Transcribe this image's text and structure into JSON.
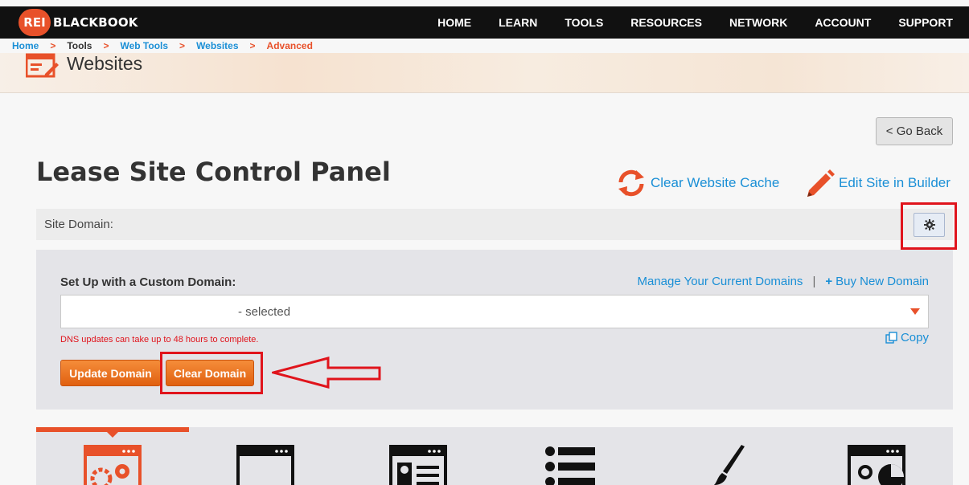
{
  "brand": {
    "badge": "REI",
    "name": "BLACKBOOK",
    "accent": "#e8512a"
  },
  "nav": {
    "items": [
      "HOME",
      "LEARN",
      "TOOLS",
      "RESOURCES",
      "NETWORK",
      "ACCOUNT",
      "SUPPORT"
    ]
  },
  "breadcrumb": {
    "items": [
      "Home",
      "Tools",
      "Web Tools",
      "Websites",
      "Advanced"
    ],
    "separator": ">"
  },
  "header": {
    "title": "Websites",
    "icon": "website-edit-icon"
  },
  "main": {
    "go_back_label": "< Go Back",
    "title": "Lease Site Control Panel",
    "actions": {
      "clear_cache_label": "Clear Website Cache",
      "edit_site_label": "Edit Site in Builder"
    },
    "site_domain_label": "Site Domain:"
  },
  "panel": {
    "label": "Set Up with a Custom Domain:",
    "manage_link": "Manage Your Current Domains",
    "link_separator": "|",
    "buy_plus": "+",
    "buy_link": "Buy New Domain",
    "select_value": "- selected",
    "dns_note": "DNS updates can take up to 48 hours to complete.",
    "copy_label": "Copy",
    "update_button": "Update Domain",
    "clear_button": "Clear Domain"
  },
  "tabs": {
    "icons": [
      "settings-window-icon",
      "window-icon",
      "profile-page-icon",
      "list-icon",
      "brush-icon",
      "analytics-window-icon"
    ]
  },
  "colors": {
    "link": "#1a8fd6",
    "accent": "#e8512a",
    "annotation": "#e0141c"
  }
}
